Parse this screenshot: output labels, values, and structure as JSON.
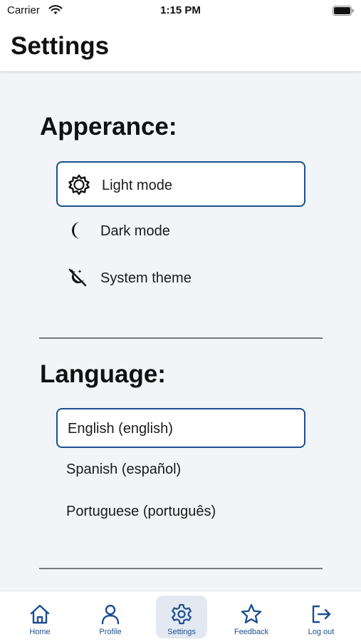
{
  "status_bar": {
    "carrier": "Carrier",
    "time": "1:15 PM"
  },
  "header": {
    "title": "Settings"
  },
  "appearance": {
    "title": "Apperance:",
    "options": [
      {
        "label": "Light mode",
        "icon": "sun-icon",
        "selected": true
      },
      {
        "label": "Dark mode",
        "icon": "moon-icon",
        "selected": false
      },
      {
        "label": "System theme",
        "icon": "theme-icon",
        "selected": false
      }
    ]
  },
  "language": {
    "title": "Language:",
    "options": [
      {
        "label": "English (english)",
        "selected": true
      },
      {
        "label": "Spanish (español)",
        "selected": false
      },
      {
        "label": "Portuguese (português)",
        "selected": false
      }
    ]
  },
  "tab_bar": {
    "items": [
      {
        "label": "Home",
        "icon": "home-icon",
        "active": false
      },
      {
        "label": "Profile",
        "icon": "profile-icon",
        "active": false
      },
      {
        "label": "Settings",
        "icon": "gear-icon",
        "active": true
      },
      {
        "label": "Feedback",
        "icon": "star-icon",
        "active": false
      },
      {
        "label": "Log out",
        "icon": "logout-icon",
        "active": false
      }
    ]
  },
  "colors": {
    "accent": "#1c4f8f",
    "background": "#f2f4f8",
    "active_tab": "#e3e9f2"
  }
}
